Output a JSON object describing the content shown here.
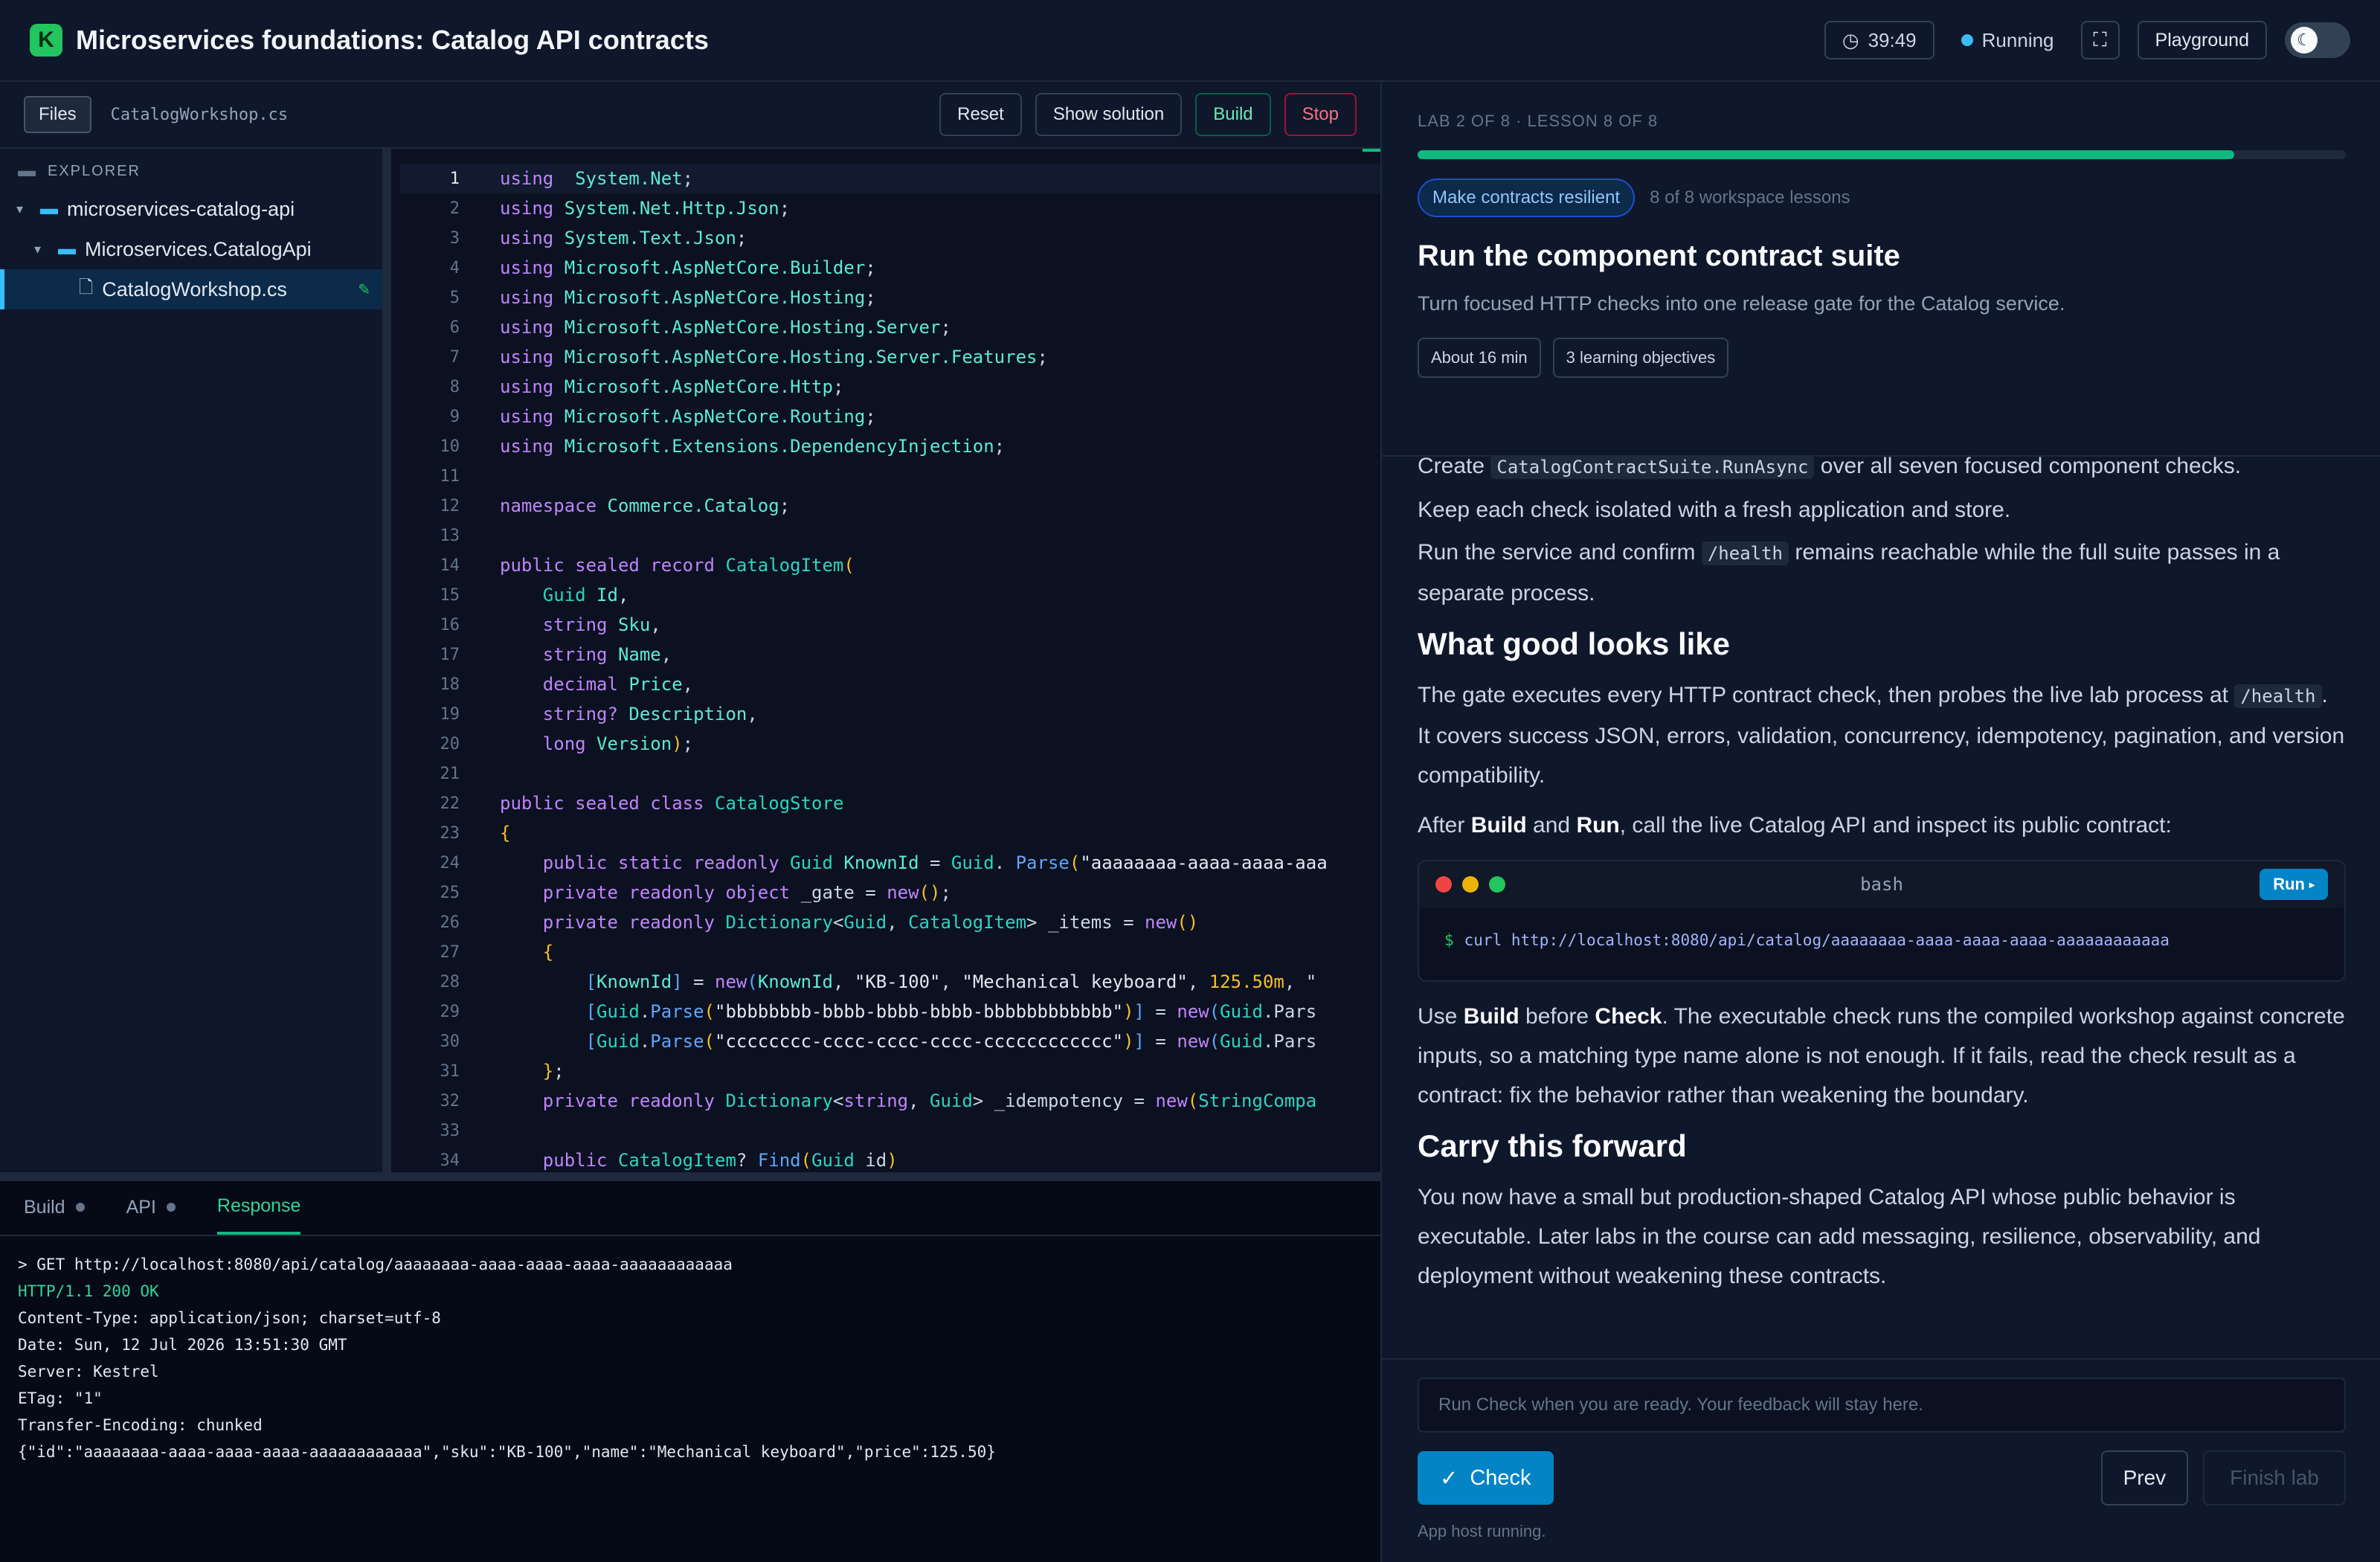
{
  "header": {
    "logo_letter": "K",
    "title": "Microservices foundations: Catalog API contracts",
    "timer": "39:49",
    "status": "Running",
    "playground_label": "Playground",
    "accent_color": "#22c55e"
  },
  "toolbar": {
    "files_tab": "Files",
    "open_file": "CatalogWorkshop.cs",
    "reset_label": "Reset",
    "show_solution_label": "Show solution",
    "build_label": "Build",
    "stop_label": "Stop"
  },
  "explorer": {
    "heading": "EXPLORER",
    "items": [
      {
        "label": "microservices-catalog-api",
        "type": "folder"
      },
      {
        "label": "Microservices.CatalogApi",
        "type": "folder"
      },
      {
        "label": "CatalogWorkshop.cs",
        "type": "file",
        "selected": true
      }
    ]
  },
  "editor": {
    "active_line": 1,
    "lines": [
      [
        [
          "kw",
          "using"
        ],
        [
          "",
          "  "
        ],
        [
          "ns",
          "System.Net"
        ],
        [
          "",
          ";"
        ]
      ],
      [
        [
          "kw",
          "using"
        ],
        [
          "",
          " "
        ],
        [
          "ns",
          "System.Net.Http.Json"
        ],
        [
          "",
          ";"
        ]
      ],
      [
        [
          "kw",
          "using"
        ],
        [
          "",
          " "
        ],
        [
          "ns",
          "System.Text.Json"
        ],
        [
          "",
          ";"
        ]
      ],
      [
        [
          "kw",
          "using"
        ],
        [
          "",
          " "
        ],
        [
          "ns",
          "Microsoft.AspNetCore.Builder"
        ],
        [
          "",
          ";"
        ]
      ],
      [
        [
          "kw",
          "using"
        ],
        [
          "",
          " "
        ],
        [
          "ns",
          "Microsoft.AspNetCore.Hosting"
        ],
        [
          "",
          ";"
        ]
      ],
      [
        [
          "kw",
          "using"
        ],
        [
          "",
          " "
        ],
        [
          "ns",
          "Microsoft.AspNetCore.Hosting.Server"
        ],
        [
          "",
          ";"
        ]
      ],
      [
        [
          "kw",
          "using"
        ],
        [
          "",
          " "
        ],
        [
          "ns",
          "Microsoft.AspNetCore.Hosting.Server.Features"
        ],
        [
          "",
          ";"
        ]
      ],
      [
        [
          "kw",
          "using"
        ],
        [
          "",
          " "
        ],
        [
          "ns",
          "Microsoft.AspNetCore.Http"
        ],
        [
          "",
          ";"
        ]
      ],
      [
        [
          "kw",
          "using"
        ],
        [
          "",
          " "
        ],
        [
          "ns",
          "Microsoft.AspNetCore.Routing"
        ],
        [
          "",
          ";"
        ]
      ],
      [
        [
          "kw",
          "using"
        ],
        [
          "",
          " "
        ],
        [
          "ns",
          "Microsoft.Extensions.DependencyInjection"
        ],
        [
          "",
          ";"
        ]
      ],
      [],
      [
        [
          "kw",
          "namespace"
        ],
        [
          "",
          " "
        ],
        [
          "ns",
          "Commerce.Catalog"
        ],
        [
          "",
          ";"
        ]
      ],
      [],
      [
        [
          "kw",
          "public sealed record"
        ],
        [
          "",
          " "
        ],
        [
          "ty",
          "CatalogItem"
        ],
        [
          "pn",
          "("
        ]
      ],
      [
        [
          "",
          "    "
        ],
        [
          "ty",
          "Guid"
        ],
        [
          "",
          " "
        ],
        [
          "ns",
          "Id"
        ],
        [
          "",
          ","
        ]
      ],
      [
        [
          "",
          "    "
        ],
        [
          "kw",
          "string"
        ],
        [
          "",
          " "
        ],
        [
          "ns",
          "Sku"
        ],
        [
          "",
          ","
        ]
      ],
      [
        [
          "",
          "    "
        ],
        [
          "kw",
          "string"
        ],
        [
          "",
          " "
        ],
        [
          "ns",
          "Name"
        ],
        [
          "",
          ","
        ]
      ],
      [
        [
          "",
          "    "
        ],
        [
          "kw",
          "decimal"
        ],
        [
          "",
          " "
        ],
        [
          "ns",
          "Price"
        ],
        [
          "",
          ","
        ]
      ],
      [
        [
          "",
          "    "
        ],
        [
          "kw",
          "string?"
        ],
        [
          "",
          " "
        ],
        [
          "ns",
          "Description"
        ],
        [
          "",
          ","
        ]
      ],
      [
        [
          "",
          "    "
        ],
        [
          "kw",
          "long"
        ],
        [
          "",
          " "
        ],
        [
          "ns",
          "Version"
        ],
        [
          "pn",
          ")"
        ],
        [
          "",
          ";"
        ]
      ],
      [],
      [
        [
          "kw",
          "public sealed class"
        ],
        [
          "",
          " "
        ],
        [
          "ty",
          "CatalogStore"
        ]
      ],
      [
        [
          "pn",
          "{"
        ]
      ],
      [
        [
          "",
          "    "
        ],
        [
          "kw",
          "public static readonly"
        ],
        [
          "",
          " "
        ],
        [
          "ty",
          "Guid"
        ],
        [
          "",
          " "
        ],
        [
          "ns",
          "KnownId"
        ],
        [
          "",
          " = "
        ],
        [
          "ty",
          "Guid"
        ],
        [
          "",
          ". "
        ],
        [
          "fn",
          "Parse"
        ],
        [
          "pn",
          "("
        ],
        [
          "str",
          "\"aaaaaaaa-aaaa-aaaa-aaa"
        ]
      ],
      [
        [
          "",
          "    "
        ],
        [
          "kw",
          "private readonly object"
        ],
        [
          "",
          " _gate = "
        ],
        [
          "kw",
          "new"
        ],
        [
          "pn",
          "()"
        ],
        [
          "",
          ";"
        ]
      ],
      [
        [
          "",
          "    "
        ],
        [
          "kw",
          "private readonly"
        ],
        [
          "",
          " "
        ],
        [
          "ty",
          "Dictionary"
        ],
        [
          "",
          "<"
        ],
        [
          "ty",
          "Guid"
        ],
        [
          "",
          ", "
        ],
        [
          "ty",
          "CatalogItem"
        ],
        [
          "",
          "> _items = "
        ],
        [
          "kw",
          "new"
        ],
        [
          "pn",
          "()"
        ]
      ],
      [
        [
          "",
          "    "
        ],
        [
          "pn",
          "{"
        ]
      ],
      [
        [
          "",
          "        "
        ],
        [
          "fn",
          "["
        ],
        [
          "ns",
          "KnownId"
        ],
        [
          "fn",
          "]"
        ],
        [
          "",
          " = "
        ],
        [
          "kw",
          "new"
        ],
        [
          "fn",
          "("
        ],
        [
          "ns",
          "KnownId"
        ],
        [
          "",
          ", "
        ],
        [
          "str",
          "\"KB-100\""
        ],
        [
          "",
          ", "
        ],
        [
          "str",
          "\"Mechanical keyboard\""
        ],
        [
          "",
          ", "
        ],
        [
          "num",
          "125.50m"
        ],
        [
          "",
          ", \""
        ]
      ],
      [
        [
          "",
          "        "
        ],
        [
          "fn",
          "["
        ],
        [
          "ty",
          "Guid"
        ],
        [
          "",
          "."
        ],
        [
          "fn",
          "Parse"
        ],
        [
          "pn",
          "("
        ],
        [
          "str",
          "\"bbbbbbbb-bbbb-bbbb-bbbb-bbbbbbbbbbbb\""
        ],
        [
          "pn",
          ")"
        ],
        [
          "fn",
          "]"
        ],
        [
          "",
          " = "
        ],
        [
          "kw",
          "new"
        ],
        [
          "fn",
          "("
        ],
        [
          "ty",
          "Guid"
        ],
        [
          "",
          ".Pars"
        ]
      ],
      [
        [
          "",
          "        "
        ],
        [
          "fn",
          "["
        ],
        [
          "ty",
          "Guid"
        ],
        [
          "",
          "."
        ],
        [
          "fn",
          "Parse"
        ],
        [
          "pn",
          "("
        ],
        [
          "str",
          "\"cccccccc-cccc-cccc-cccc-cccccccccccc\""
        ],
        [
          "pn",
          ")"
        ],
        [
          "fn",
          "]"
        ],
        [
          "",
          " = "
        ],
        [
          "kw",
          "new"
        ],
        [
          "fn",
          "("
        ],
        [
          "ty",
          "Guid"
        ],
        [
          "",
          ".Pars"
        ]
      ],
      [
        [
          "",
          "    "
        ],
        [
          "pn",
          "}"
        ],
        [
          "",
          ";"
        ]
      ],
      [
        [
          "",
          "    "
        ],
        [
          "kw",
          "private readonly"
        ],
        [
          "",
          " "
        ],
        [
          "ty",
          "Dictionary"
        ],
        [
          "",
          "<"
        ],
        [
          "kw",
          "string"
        ],
        [
          "",
          ", "
        ],
        [
          "ty",
          "Guid"
        ],
        [
          "",
          "> _idempotency = "
        ],
        [
          "kw",
          "new"
        ],
        [
          "pn",
          "("
        ],
        [
          "ty",
          "StringCompa"
        ]
      ],
      [],
      [
        [
          "",
          "    "
        ],
        [
          "kw",
          "public"
        ],
        [
          "",
          " "
        ],
        [
          "ty",
          "CatalogItem"
        ],
        [
          "",
          "? "
        ],
        [
          "fn",
          "Find"
        ],
        [
          "pn",
          "("
        ],
        [
          "ty",
          "Guid"
        ],
        [
          "",
          " id"
        ],
        [
          "pn",
          ")"
        ]
      ]
    ]
  },
  "bottom": {
    "tabs": [
      {
        "label": "Build",
        "active": false
      },
      {
        "label": "API",
        "active": false
      },
      {
        "label": "Response",
        "active": true
      }
    ],
    "response_lines": [
      "> GET http://localhost:8080/api/catalog/aaaaaaaa-aaaa-aaaa-aaaa-aaaaaaaaaaaa",
      "HTTP/1.1 200 OK",
      "Content-Type: application/json; charset=utf-8",
      "Date: Sun, 12 Jul 2026 13:51:30 GMT",
      "Server: Kestrel",
      "ETag: \"1\"",
      "Transfer-Encoding: chunked",
      "{\"id\":\"aaaaaaaa-aaaa-aaaa-aaaa-aaaaaaaaaaaa\",\"sku\":\"KB-100\",\"name\":\"Mechanical keyboard\",\"price\":125.50}"
    ]
  },
  "lesson": {
    "crumb": "LAB 2 OF 8 · LESSON 8 OF 8",
    "progress": 0.88,
    "chip": "Make contracts resilient",
    "chip_sub": "8 of 8 workspace lessons",
    "title": "Run the component contract suite",
    "subtitle": "Turn focused HTTP checks into one release gate for the Catalog service.",
    "tags": [
      "About 16 min",
      "3 learning objectives"
    ],
    "p1_a": "Create ",
    "p1_code": "CatalogContractSuite.RunAsync",
    "p1_b": " over all seven focused component checks.",
    "p2": "Keep each check isolated with a fresh application and store.",
    "p3_a": "Run the service and confirm ",
    "p3_code": "/health",
    "p3_b": " remains reachable while the full suite passes in a separate process.",
    "h_good": "What good looks like",
    "p4_a": "The gate executes every HTTP contract check, then probes the live lab process at ",
    "p4_code": "/health",
    "p4_b": ". It covers success JSON, errors, validation, concurrency, idempotency, pagination, and version compatibility.",
    "p5_a": "After ",
    "p5_b1": "Build",
    "p5_c": " and ",
    "p5_b2": "Run",
    "p5_d": ", call the live Catalog API and inspect its public contract:",
    "term_title": "bash",
    "term_run": "Run",
    "term_prompt": "$",
    "term_cmd": "curl http://localhost:8080/api/catalog/aaaaaaaa-aaaa-aaaa-aaaa-aaaaaaaaaaaa",
    "p6_a": "Use ",
    "p6_b1": "Build",
    "p6_c": " before ",
    "p6_b2": "Check",
    "p6_d": ". The executable check runs the compiled workshop against concrete inputs, so a matching type name alone is not enough. If it fails, read the check result as a contract: fix the behavior rather than weakening the boundary.",
    "h_forward": "Carry this forward",
    "p7": "You now have a small but production-shaped Catalog API whose public behavior is executable. Later labs in the course can add messaging, resilience, observability, and deployment without weakening these contracts."
  },
  "footer": {
    "feedback_placeholder": "Run Check when you are ready. Your feedback will stay here.",
    "check_label": "Check",
    "prev_label": "Prev",
    "finish_label": "Finish lab",
    "host_status": "App host running."
  }
}
